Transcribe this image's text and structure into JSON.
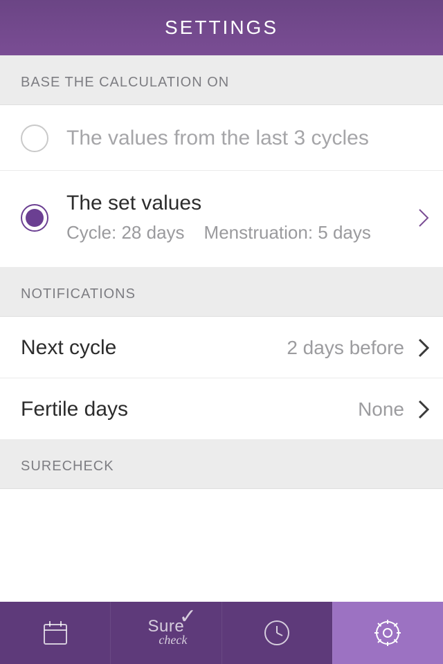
{
  "header": {
    "title": "SETTINGS"
  },
  "sections": {
    "calculation": {
      "header": "BASE THE CALCULATION ON",
      "option_last_cycles": "The values from the last 3 cycles",
      "option_set_values": "The set values",
      "sub_cycle": "Cycle: 28 days",
      "sub_mens": "Menstruation: 5 days"
    },
    "notifications": {
      "header": "NOTIFICATIONS",
      "next_cycle_label": "Next cycle",
      "next_cycle_value": "2 days before",
      "fertile_label": "Fertile days",
      "fertile_value": "None"
    },
    "surecheck": {
      "header": "SURECHECK"
    }
  },
  "tabs": {
    "calendar": "Calendar",
    "surecheck": "Surecheck",
    "history": "History",
    "settings": "Settings"
  },
  "logo": {
    "line1": "Sure",
    "line2": "check"
  },
  "colors": {
    "accent": "#6b3f92",
    "header_grad_top": "#6b4585",
    "header_grad_bot": "#7a4d94",
    "tab_bg": "#5e3a7a",
    "tab_active": "#9c72c2"
  }
}
